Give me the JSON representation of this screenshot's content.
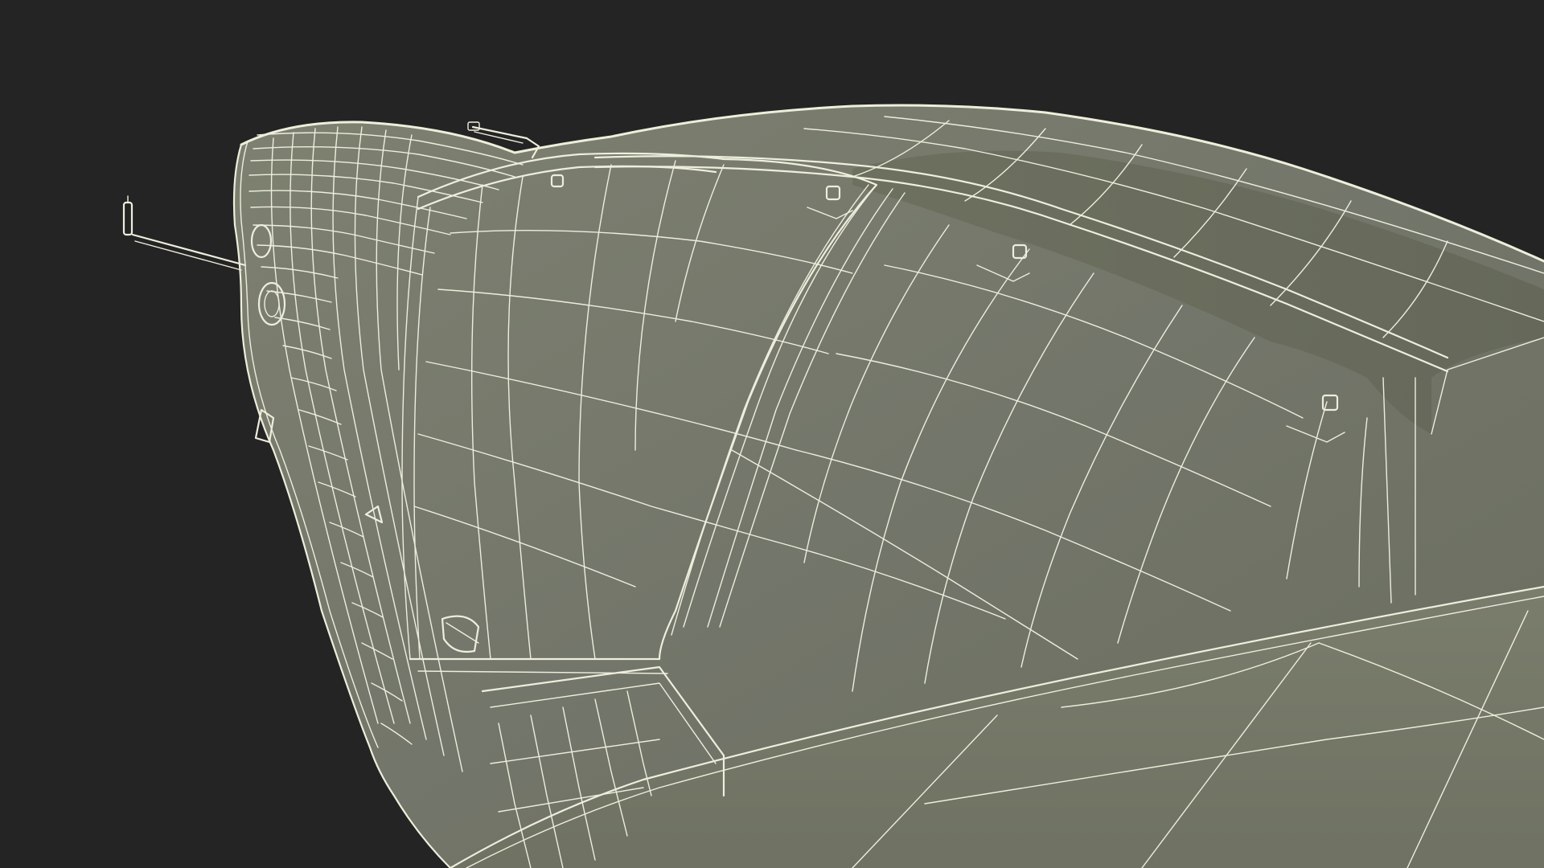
{
  "scene": {
    "subject": "wireframe-3d-model",
    "background_color": "#242424",
    "surface_color": "#777a69",
    "wire_color": "#eeeedd"
  }
}
